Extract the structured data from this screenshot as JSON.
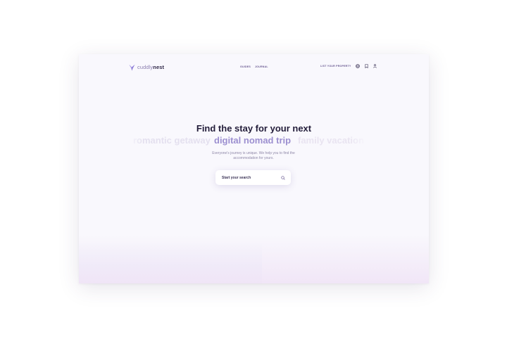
{
  "brand": {
    "name_light": "cuddly",
    "name_bold": "nest"
  },
  "nav": {
    "items": [
      "GUIDES",
      "JOURNAL"
    ]
  },
  "header_right": {
    "list_property": "LIST YOUR PROPERTY"
  },
  "hero": {
    "title": "Find the stay for your next",
    "rotating_phrases": [
      "romantic getaway",
      "digital nomad trip",
      "family vacation"
    ],
    "subtitle": "Everyone's journey is unique. We help you to find the accommodation for yours."
  },
  "search": {
    "label": "Start your search"
  },
  "colors": {
    "accent": "#9c8fd0",
    "text_dark": "#231d3a",
    "nav": "#6a5a92"
  }
}
